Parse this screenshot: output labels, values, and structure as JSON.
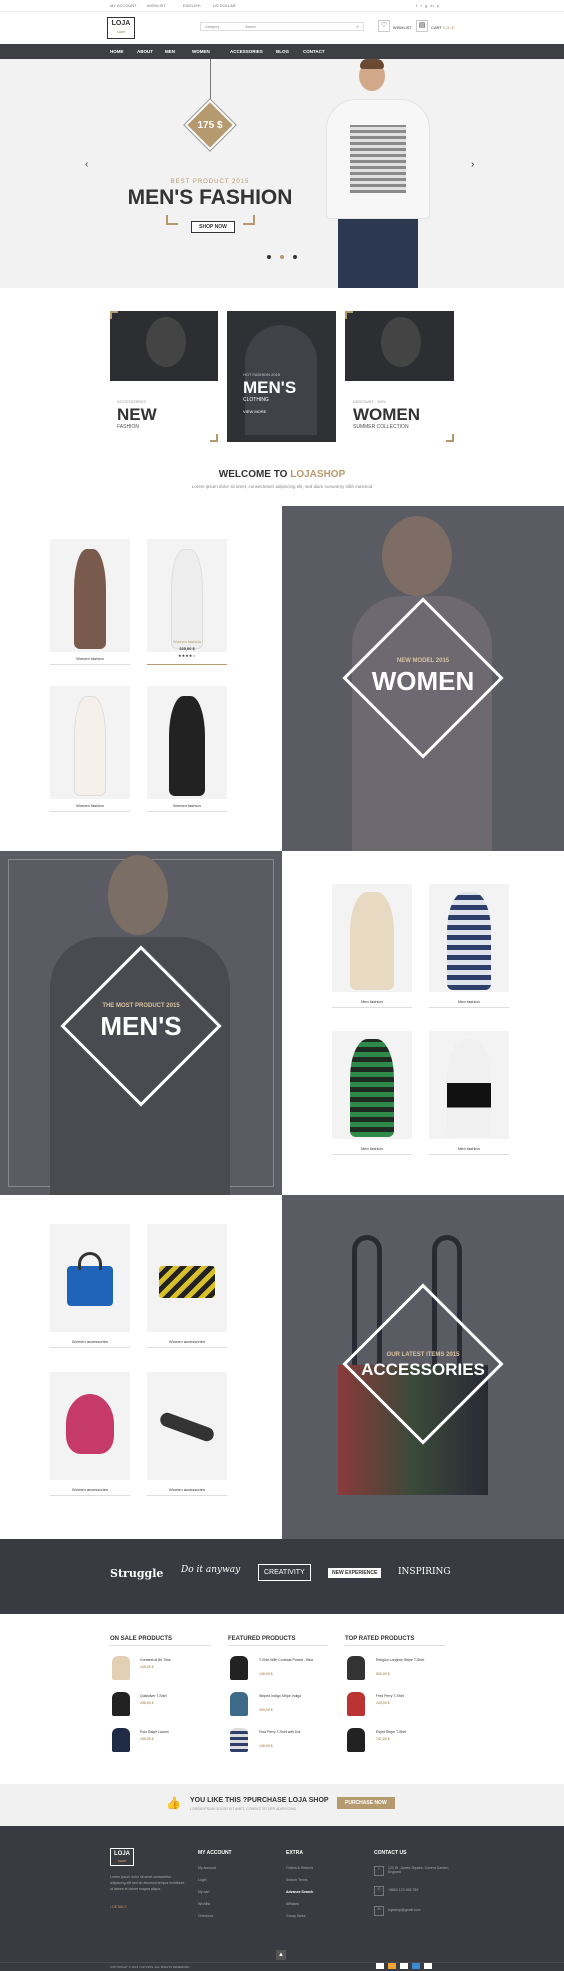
{
  "topbar": {
    "my_account": "MY ACCOUNT",
    "wishlist": "WISHLIST",
    "language": "ENGLISH",
    "currency": "US DOLLAR"
  },
  "header": {
    "logo": "LOJA",
    "logo_sub": "SHOP",
    "category": "Category",
    "search_placeholder": "Search",
    "wishlist": "WISHLIST",
    "cart": "CART",
    "cart_total": "0,00 $",
    "cart_count": "0"
  },
  "nav": [
    "HOME",
    "ABOUT",
    "MEN",
    "WOMEN",
    "ACCESSORIES",
    "BLOG",
    "CONTACT"
  ],
  "hero": {
    "price": "175 $",
    "kicker": "BEST PRODUCT 2015",
    "title": "MEN'S FASHION",
    "button": "SHOP NOW"
  },
  "banners": [
    {
      "kicker": "ACCESSORIES",
      "title": "NEW",
      "sub": "FASHION"
    },
    {
      "kicker": "HOT FASHION 2015",
      "title": "MEN'S",
      "sub": "CLOTHING",
      "link": "VIEW MORE"
    },
    {
      "kicker": "DISCOUNT - 50%",
      "title": "WOMEN",
      "sub": "SUMMER COLLECTION"
    }
  ],
  "welcome": {
    "title_a": "WELCOME TO ",
    "title_b": "LOJASHOP",
    "text": "Lorem ipsum dolor sit amet, consectetuer adipiscing elit, sed diam nonummy nibh euismod"
  },
  "women_section": {
    "products": [
      {
        "name": "Women fashion"
      },
      {
        "name": "Women fashion",
        "price": "225,00 $"
      },
      {
        "name": "Women fashion"
      },
      {
        "name": "Women fashion"
      }
    ],
    "kicker": "NEW MODEL 2015",
    "title": "WOMEN"
  },
  "men_section": {
    "kicker": "THE MOST PRODUCT 2015",
    "title": "MEN'S",
    "products": [
      "Men fashion",
      "Men fashion",
      "Men fashion",
      "Men fashion"
    ]
  },
  "acc_section": {
    "kicker": "OUR LATEST ITEMS 2015",
    "title": "ACCESSORIES",
    "products": [
      "Women accessories",
      "Women accessories",
      "Women accessories",
      "Women accessories"
    ]
  },
  "brands": [
    "Struggle",
    "Do it anyway",
    "CREATIVITY",
    "NEW EXPERIENCE",
    "INSPIRING"
  ],
  "lists": [
    {
      "title": "ON SALE PRODUCTS",
      "items": [
        {
          "name": "Greatest at 8d Time",
          "price": "125,00 $"
        },
        {
          "name": "Quiksilver T-Shirt",
          "price": "256,00 $"
        },
        {
          "name": "Polo Ralph Lauren",
          "price": "150,00 $"
        }
      ]
    },
    {
      "title": "FEATURED PRODUCTS",
      "items": [
        {
          "name": "T-Shirt With Contrast Pocket - Blue",
          "price": "129,00 $"
        },
        {
          "name": "Striped Indigo Stripe Indigo",
          "price": "209,00 $"
        },
        {
          "name": "Fred Perry T-Shirt with Dot",
          "price": "129,00 $"
        }
      ]
    },
    {
      "title": "TOP RATED PRODUCTS",
      "items": [
        {
          "name": "Religion Longline Stripe T-Shirt",
          "price": "500,00 $"
        },
        {
          "name": "Fred Perry T-Shirt",
          "price": "129,00 $"
        },
        {
          "name": "Esprit Stripe T-Shirt",
          "price": "747,00 $"
        }
      ]
    }
  ],
  "cta": {
    "text": "YOU LIKE THIS ?PURCHASE LOJA SHOP",
    "sub": "LOREM IPSUM DOLOR SIT AMET, CONSECTETUER ADIPISCING",
    "button": "PURCHASE NOW"
  },
  "footer": {
    "about": "Lorem ipsum dolor sit amet consectetur adipiscing elit sed do eiusmod tempor incididunt ut labore et dolore magna aliqua.",
    "details": "DETAILS",
    "col1": {
      "title": "MY ACCOUNT",
      "links": [
        "My account",
        "Login",
        "My cart",
        "Wishlist",
        "Checkout"
      ]
    },
    "col2": {
      "title": "EXTRA",
      "links": [
        "Orders & Returns",
        "Search Terms",
        "Advance Search",
        "Affiliates",
        "Group Sales"
      ]
    },
    "col3": {
      "title": "CONTACT US",
      "address": "123 St. James Square, Covent Garden, England",
      "phone": "+8800 123 456 789",
      "email": "lojashop@gmail.com"
    },
    "copyright": "COPYRIGHT © 2015 7UPCSSS. ALL RIGHTS RESERVED."
  },
  "colors": {
    "accent": "#b59a6f",
    "dark": "#3d3f43",
    "panel": "#5b5c63"
  }
}
